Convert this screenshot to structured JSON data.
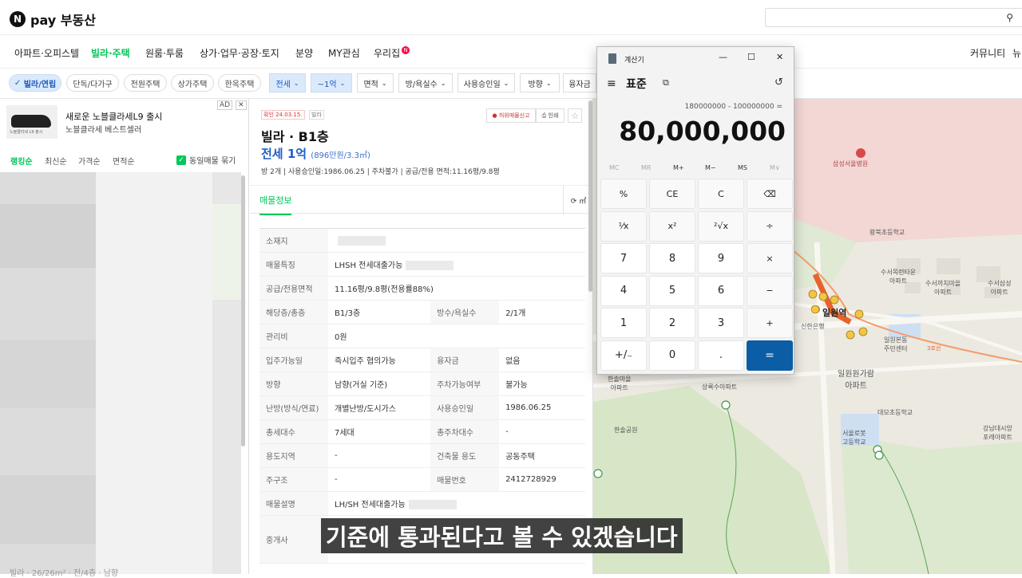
{
  "header": {
    "logo_letter": "N",
    "brand": "pay 부동산",
    "search_icon": "search-icon"
  },
  "nav": {
    "items": [
      "아파트·오피스텔",
      "빌라·주택",
      "원룸·투룸",
      "상가·업무·공장·토지",
      "분양",
      "MY관심",
      "우리집"
    ],
    "active_index": 1,
    "badge": "N",
    "right_items": [
      "커뮤니티",
      "뉴"
    ]
  },
  "filters": {
    "chips": [
      "빌라/연립",
      "단독/다가구",
      "전원주택",
      "상가주택",
      "한옥주택"
    ],
    "dropdowns": [
      "전세",
      "~1억",
      "면적",
      "방/욕실수",
      "사용승인일",
      "방향",
      "융자금"
    ]
  },
  "ad": {
    "label": "AD",
    "close": "✕",
    "title": "새로운 노블클라세L9 출시",
    "subtitle": "노블클라세 베스트셀러",
    "thumb_text": "노블클라세 L9 출시"
  },
  "sort": {
    "items": [
      "랭킹순",
      "최신순",
      "가격순",
      "면적순"
    ],
    "dup_label": "동일매물 묶기"
  },
  "list_bottom": "빌라 · 26/26m² · 전/4층 · 남향",
  "detail": {
    "tag_confirm": "확인 24.03.15.",
    "tag_type": "빌라",
    "report": "허위매물신고",
    "print": "인쇄",
    "title": "빌라 · B1층",
    "price": "전세 1억",
    "price_sub": "(896만원/3.3㎡)",
    "summary": "방 2개 | 사용승인일:1986.06.25 | 주차불가 | 공급/전용 면적:11.16평/9.8평",
    "tab": "매물정보",
    "tool": "⟳ ㎡",
    "rows": [
      {
        "k": "소재지",
        "v": ""
      },
      {
        "k": "매물특징",
        "v": "LHSH 전세대출가능"
      },
      {
        "k": "공급/전용면적",
        "v": "11.16평/9.8평(전용률88%)"
      },
      {
        "k": "해당층/총층",
        "v": "B1/3층",
        "k2": "방수/욕실수",
        "v2": "2/1개"
      },
      {
        "k": "관리비",
        "v": "0원"
      },
      {
        "k": "입주가능일",
        "v": "즉시입주 협의가능",
        "k2": "융자금",
        "v2": "없음"
      },
      {
        "k": "방향",
        "v": "남향(거실 기준)",
        "k2": "주차가능여부",
        "v2": "불가능"
      },
      {
        "k": "난방(방식/연료)",
        "v": "개별난방/도시가스",
        "k2": "사용승인일",
        "v2": "1986.06.25"
      },
      {
        "k": "총세대수",
        "v": "7세대",
        "k2": "총주차대수",
        "v2": "-"
      },
      {
        "k": "용도지역",
        "v": "-",
        "k2": "건축물 용도",
        "v2": "공동주택"
      },
      {
        "k": "주구조",
        "v": "-",
        "k2": "매물번호",
        "v2": "2412728929"
      },
      {
        "k": "매물설명",
        "v": "LH/SH 전세대출가능"
      },
      {
        "k": "중개사",
        "v": ""
      }
    ]
  },
  "map": {
    "labels": {
      "hospital": "삼성서울병원",
      "school1": "왕북초등학교",
      "apt1": "수서목련타운\n아파트",
      "apt2": "수서까치마을\n아파트",
      "apt3": "수서삼성\n아파트",
      "station": "일원역",
      "bank": "신한은행",
      "center": "일원본동\n주민센터",
      "line": "3호선",
      "apt4": "한솔마을\n아파트",
      "apt5": "상록수아파트",
      "apt6": "일원원가람\n아파트",
      "school2": "대모초등학교",
      "hs": "서울로봇\n고등학교",
      "apt7": "한솔공원",
      "apt8": "강남대시앙\n포레아파트"
    },
    "colors": {
      "road": "#f6f4ee",
      "green": "#d4e6c8",
      "hospital": "#f2d7d5",
      "route": "#e8632b"
    }
  },
  "calculator": {
    "title": "계산기",
    "mode": "표준",
    "expression": "180000000 - 100000000 =",
    "display": "80,000,000",
    "memory": [
      "MC",
      "MR",
      "M+",
      "M−",
      "MS",
      "M∨"
    ],
    "keys": [
      [
        "%",
        "CE",
        "C",
        "⌫"
      ],
      [
        "¹⁄x",
        "x²",
        "²√x",
        "÷"
      ],
      [
        "7",
        "8",
        "9",
        "×"
      ],
      [
        "4",
        "5",
        "6",
        "−"
      ],
      [
        "1",
        "2",
        "3",
        "+"
      ],
      [
        "+/₋",
        "0",
        ".",
        "="
      ]
    ]
  },
  "subtitle": "기준에 통과된다고 볼 수 있겠습니다"
}
